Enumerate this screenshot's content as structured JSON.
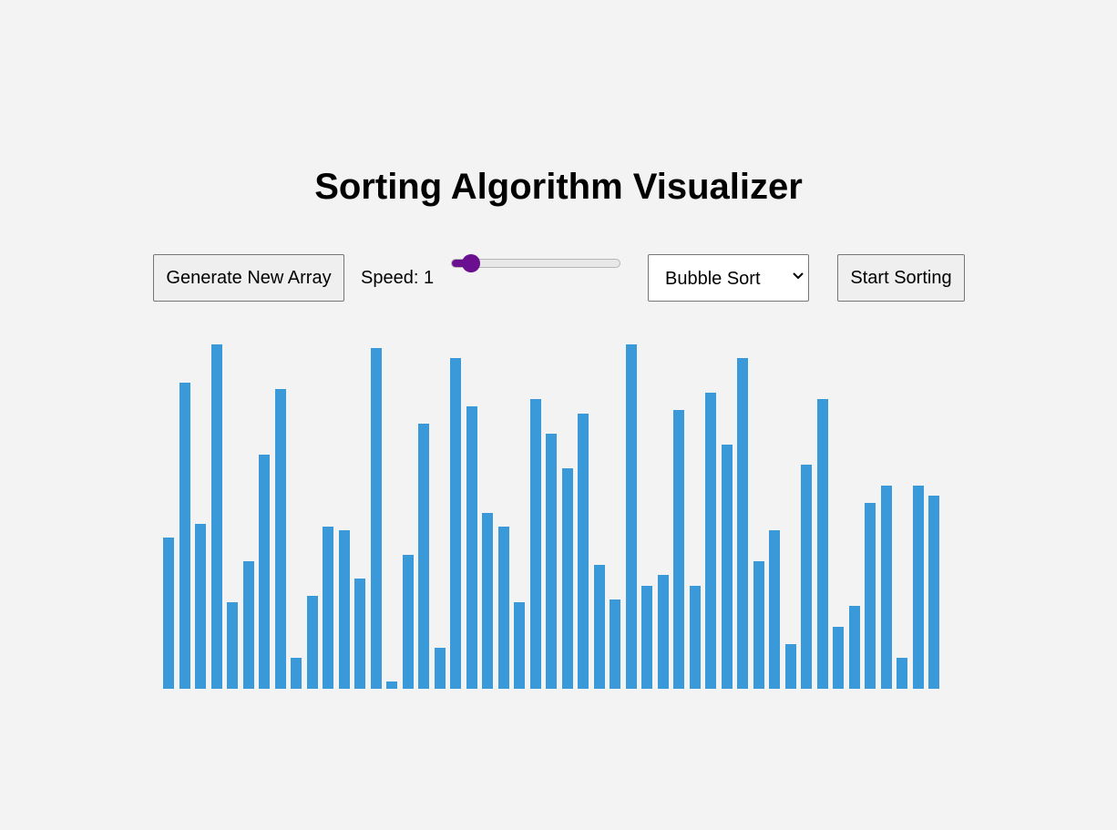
{
  "title": "Sorting Algorithm Visualizer",
  "controls": {
    "generate_label": "Generate New Array",
    "speed_label": "Speed: 1",
    "speed": {
      "value": 1,
      "min": 1,
      "max": 10
    },
    "algorithm_selected": "Bubble Sort",
    "start_label": "Start Sorting"
  },
  "colors": {
    "bar": "#3a9ad9",
    "slider_accent": "#6a0f8f",
    "background": "#f3f3f3"
  },
  "chart_data": {
    "type": "bar",
    "ylim": [
      0,
      100
    ],
    "values": [
      44,
      89,
      48,
      100,
      25,
      37,
      68,
      87,
      9,
      27,
      47,
      46,
      32,
      99,
      2,
      39,
      77,
      12,
      96,
      82,
      51,
      47,
      25,
      84,
      74,
      64,
      80,
      36,
      26,
      100,
      30,
      33,
      81,
      30,
      86,
      71,
      96,
      37,
      46,
      13,
      65,
      84,
      18,
      24,
      54,
      59,
      9,
      59,
      56
    ]
  }
}
